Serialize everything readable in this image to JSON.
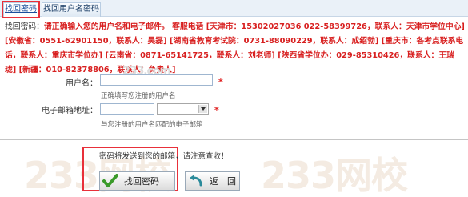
{
  "tabs": [
    {
      "label": "找回密码",
      "active": true
    },
    {
      "label": "找回用户名密码",
      "active": false
    }
  ],
  "notice": {
    "lead": "找回密码：",
    "text": "请正确输入您的用户名和电子邮件。 客服电话 [天津市：15302027036 022-58399726，联系人：天津市学位中心] [安徽省：0551-62901150，联系人：吴磊] [湖南省教育考试院：0731-88090229，联系人：成绍勃] [重庆市：各考点联系电话，联系人：重庆市学位办] [云南省：0871-65141725，联系人：刘老师] [陕西省学位办：029-85310426，联系人：王瑞珑] [新疆：010-82378806，联系人：负责人]"
  },
  "form": {
    "username_label": "用户名：",
    "username_value": "",
    "username_hint": "正确填写您注册的用户名",
    "email_label": "电子邮箱地址：",
    "email_value": "",
    "email_domain_selected": "",
    "email_hint": "与您注册的用户名匹配的电子邮箱",
    "required_mark": "*"
  },
  "send_note": "密码将发送到您的邮箱，请注意查收！",
  "buttons": {
    "find_label": "找回密码",
    "back_label": "返　回"
  },
  "watermark": {
    "small": "233.com",
    "big1": "233网校",
    "big2": "233网校"
  },
  "colors": {
    "notice_red": "#d81f1f",
    "highlight": "#e8303a",
    "tab_bg": "#eaf1f8"
  },
  "icons": {
    "find": "check-icon",
    "back": "undo-arrow-icon"
  }
}
